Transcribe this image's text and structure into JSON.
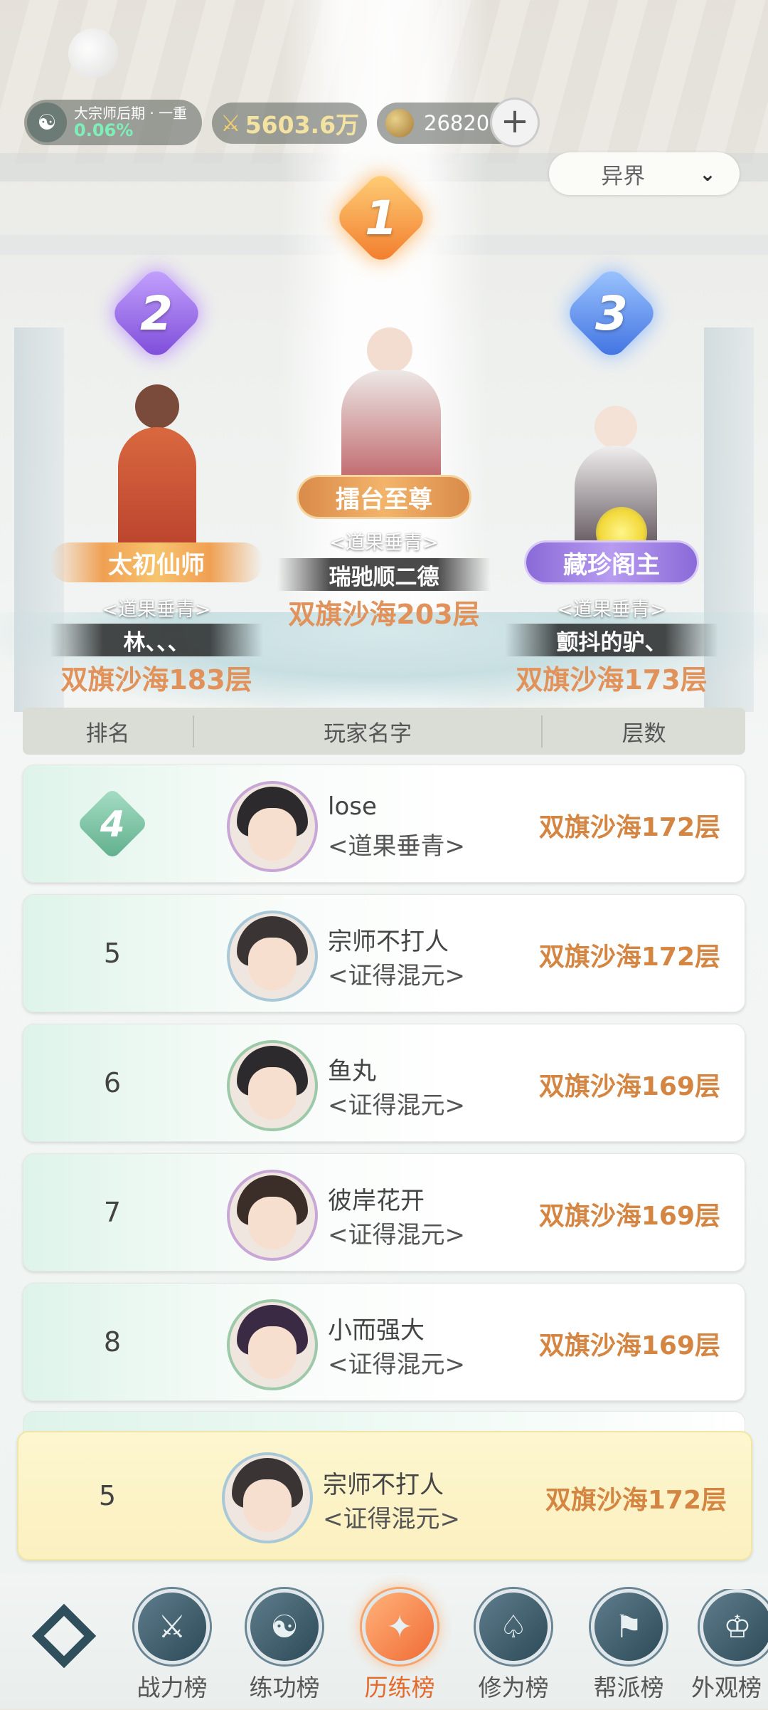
{
  "hud": {
    "realm": {
      "label": "大宗师后期 · 一重",
      "progress": "0.06%"
    },
    "power": "5603.6万",
    "currency": "26820",
    "server": "异界"
  },
  "podium": [
    {
      "rank": "1",
      "honor": "擂台至尊",
      "title": "<道果垂青>",
      "name": "瑞驰顺二德",
      "floor": "双旗沙海203层"
    },
    {
      "rank": "2",
      "honor": "太初仙师",
      "title": "<道果垂青>",
      "name": "林、、、",
      "floor": "双旗沙海183层"
    },
    {
      "rank": "3",
      "honor": "藏珍阁主",
      "title": "<道果垂青>",
      "name": "颤抖的驴、",
      "floor": "双旗沙海173层"
    }
  ],
  "table": {
    "headers": {
      "rank": "排名",
      "name": "玩家名字",
      "floor": "层数"
    },
    "rows": [
      {
        "rank": "4",
        "name": "lose",
        "title": "<道果垂青>",
        "floor": "双旗沙海172层"
      },
      {
        "rank": "5",
        "name": "宗师不打人",
        "title": "<证得混元>",
        "floor": "双旗沙海172层"
      },
      {
        "rank": "6",
        "name": "鱼丸",
        "title": "<证得混元>",
        "floor": "双旗沙海169层"
      },
      {
        "rank": "7",
        "name": "彼岸花开",
        "title": "<证得混元>",
        "floor": "双旗沙海169层"
      },
      {
        "rank": "8",
        "name": "小而强大",
        "title": "<证得混元>",
        "floor": "双旗沙海169层"
      }
    ],
    "mine": {
      "rank": "5",
      "name": "宗师不打人",
      "title": "<证得混元>",
      "floor": "双旗沙海172层"
    }
  },
  "nav": {
    "tabs": [
      {
        "label": "战力榜",
        "icon": "sword-icon"
      },
      {
        "label": "练功榜",
        "icon": "yin-yang-icon"
      },
      {
        "label": "历练榜",
        "icon": "star-burst-icon",
        "active": true
      },
      {
        "label": "修为榜",
        "icon": "hat-icon"
      },
      {
        "label": "帮派榜",
        "icon": "banner-icon"
      },
      {
        "label": "外观榜",
        "icon": "costume-icon"
      }
    ]
  },
  "colors": {
    "accent": "#e46a2c",
    "floor_text": "#d48541",
    "rank1": "#f1792a",
    "rank2": "#7a48d8",
    "rank3": "#3d6fe0"
  }
}
